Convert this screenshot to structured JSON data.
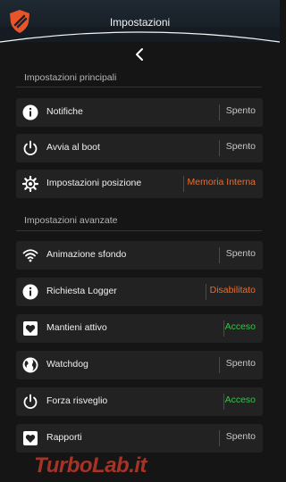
{
  "header": {
    "title": "Impostazioni",
    "logo_icon": "shield-logo-icon",
    "back_icon": "chevron-left-icon"
  },
  "sections": [
    {
      "title": "Impostazioni principali",
      "items": [
        {
          "label": "Notifiche",
          "value": "Spento",
          "icon": "info-icon"
        },
        {
          "label": "Avvia al boot",
          "value": "Spento",
          "icon": "power-icon"
        },
        {
          "label": "Impostazioni posizione",
          "value": "Memoria Interna",
          "icon": "gear-icon"
        }
      ]
    },
    {
      "title": "Impostazioni avanzate",
      "items": [
        {
          "label": "Animazione sfondo",
          "value": "Spento",
          "icon": "wifi-icon"
        },
        {
          "label": "Richiesta Logger",
          "value": "Disabilitato",
          "icon": "info-icon"
        },
        {
          "label": "Mantieni attivo",
          "value": "Acceso",
          "icon": "heart-icon"
        },
        {
          "label": "Watchdog",
          "value": "Spento",
          "icon": "globe-icon"
        },
        {
          "label": "Forza risveglio",
          "value": "Acceso",
          "icon": "power-icon"
        },
        {
          "label": "Rapporti",
          "value": "Spento",
          "icon": "heart-icon"
        }
      ]
    }
  ],
  "watermark": "TurboLab.it",
  "colors": {
    "off": "#c8c8c8",
    "warning": "#ee6b2b",
    "on": "#38c24a",
    "background": "#151515",
    "row": "#222222"
  }
}
